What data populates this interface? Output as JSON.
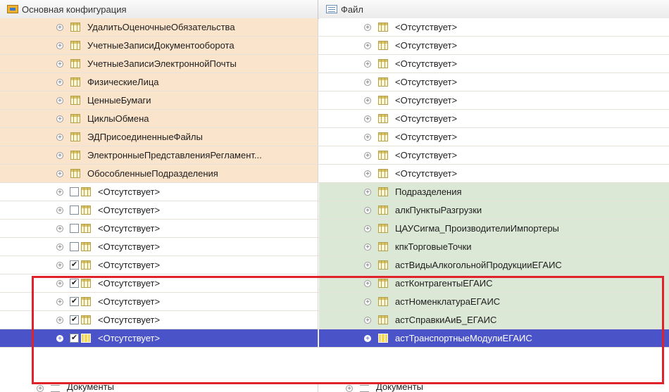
{
  "header": {
    "left_title": "Основная конфигурация",
    "right_title": "Файл",
    "left_icon": "configuration-icon",
    "right_icon": "file-icon"
  },
  "colors": {
    "orange_row": "#fbe4cc",
    "green_row": "#dbe8d6",
    "selected_row": "#4a54c8",
    "highlight_frame": "#e1222a"
  },
  "rows": [
    {
      "left": "УдалитьОценочныеОбязательства",
      "right": "<Отсутствует>",
      "left_bg": "orange",
      "right_bg": "white",
      "checkbox": "none"
    },
    {
      "left": "УчетныеЗаписиДокументооборота",
      "right": "<Отсутствует>",
      "left_bg": "orange",
      "right_bg": "white",
      "checkbox": "none"
    },
    {
      "left": "УчетныеЗаписиЭлектроннойПочты",
      "right": "<Отсутствует>",
      "left_bg": "orange",
      "right_bg": "white",
      "checkbox": "none"
    },
    {
      "left": "ФизическиеЛица",
      "right": "<Отсутствует>",
      "left_bg": "orange",
      "right_bg": "white",
      "checkbox": "none"
    },
    {
      "left": "ЦенныеБумаги",
      "right": "<Отсутствует>",
      "left_bg": "orange",
      "right_bg": "white",
      "checkbox": "none"
    },
    {
      "left": "ЦиклыОбмена",
      "right": "<Отсутствует>",
      "left_bg": "orange",
      "right_bg": "white",
      "checkbox": "none"
    },
    {
      "left": "ЭДПрисоединенныеФайлы",
      "right": "<Отсутствует>",
      "left_bg": "orange",
      "right_bg": "white",
      "checkbox": "none"
    },
    {
      "left": "ЭлектронныеПредставленияРегламент...",
      "right": "<Отсутствует>",
      "left_bg": "orange",
      "right_bg": "white",
      "checkbox": "none"
    },
    {
      "left": "ОбособленныеПодразделения",
      "right": "<Отсутствует>",
      "left_bg": "orange",
      "right_bg": "white",
      "checkbox": "none"
    },
    {
      "left": "<Отсутствует>",
      "right": "Подразделения",
      "left_bg": "white",
      "right_bg": "green",
      "checkbox": "unchecked"
    },
    {
      "left": "<Отсутствует>",
      "right": "алкПунктыРазгрузки",
      "left_bg": "white",
      "right_bg": "green",
      "checkbox": "unchecked"
    },
    {
      "left": "<Отсутствует>",
      "right": "ЦАУСигма_ПроизводителиИмпортеры",
      "left_bg": "white",
      "right_bg": "green",
      "checkbox": "unchecked"
    },
    {
      "left": "<Отсутствует>",
      "right": "кпкТорговыеТочки",
      "left_bg": "white",
      "right_bg": "green",
      "checkbox": "unchecked"
    },
    {
      "left": "<Отсутствует>",
      "right": "астВидыАлкогольнойПродукцииЕГАИС",
      "left_bg": "white",
      "right_bg": "green",
      "checkbox": "checked"
    },
    {
      "left": "<Отсутствует>",
      "right": "астКонтрагентыЕГАИС",
      "left_bg": "white",
      "right_bg": "green",
      "checkbox": "checked"
    },
    {
      "left": "<Отсутствует>",
      "right": "астНоменклатураЕГАИС",
      "left_bg": "white",
      "right_bg": "green",
      "checkbox": "checked"
    },
    {
      "left": "<Отсутствует>",
      "right": "астСправкиАиБ_ЕГАИС",
      "left_bg": "white",
      "right_bg": "green",
      "checkbox": "checked"
    },
    {
      "left": "<Отсутствует>",
      "right": "астТранспортныеМодулиЕГАИС",
      "left_bg": "white",
      "right_bg": "green",
      "checkbox": "checked",
      "selected": true
    }
  ],
  "bottom_group": {
    "left": "Документы",
    "right": "Документы"
  }
}
